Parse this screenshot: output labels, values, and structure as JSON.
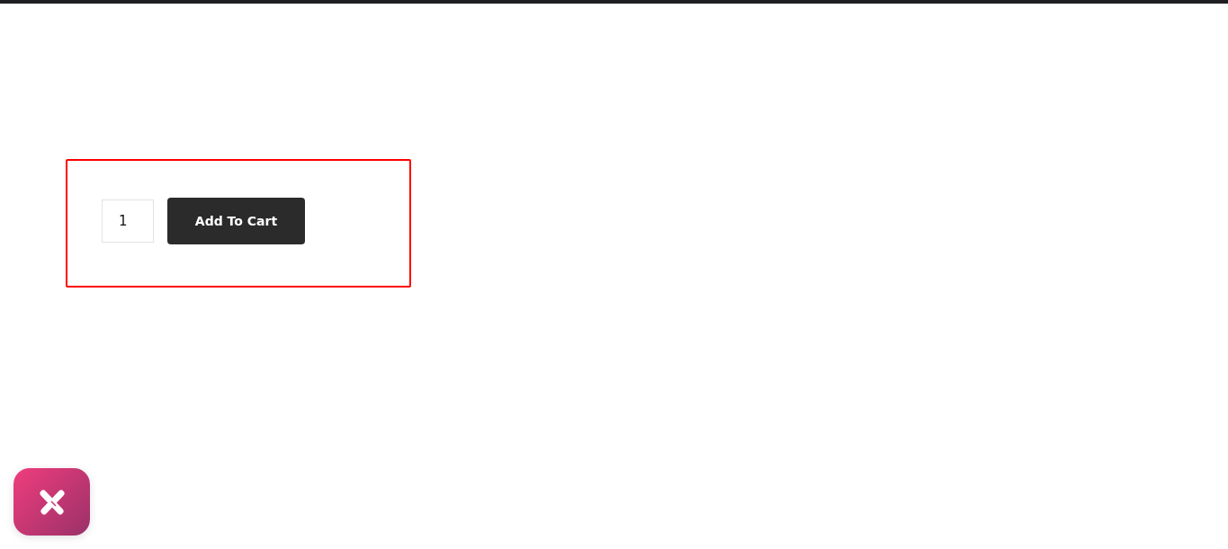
{
  "quantity": {
    "value": "1"
  },
  "add_to_cart_button": {
    "label": "Add To Cart"
  }
}
